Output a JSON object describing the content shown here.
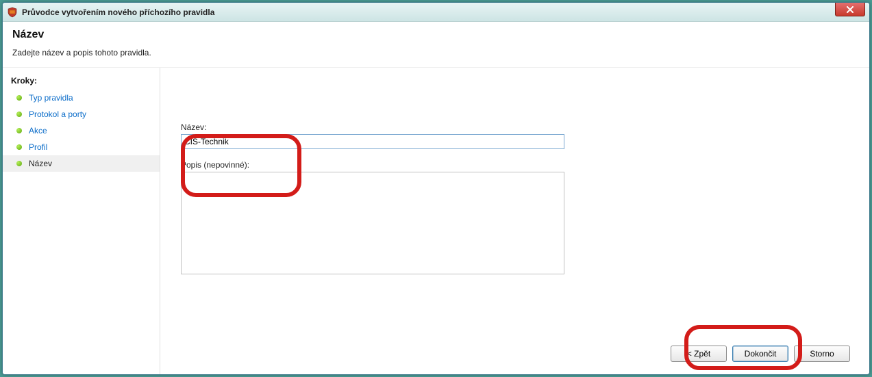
{
  "window": {
    "title": "Průvodce vytvořením nového příchozího pravidla"
  },
  "header": {
    "title": "Název",
    "subtitle": "Zadejte název a popis tohoto pravidla."
  },
  "sidebar": {
    "steps_label": "Kroky:",
    "items": [
      {
        "label": "Typ pravidla"
      },
      {
        "label": "Protokol a porty"
      },
      {
        "label": "Akce"
      },
      {
        "label": "Profil"
      },
      {
        "label": "Název"
      }
    ],
    "active_index": 4
  },
  "form": {
    "name_label": "Název:",
    "name_value": "CIS-Technik",
    "desc_label": "Popis (nepovinné):",
    "desc_value": ""
  },
  "buttons": {
    "back": "< Zpět",
    "finish": "Dokončit",
    "cancel": "Storno"
  }
}
